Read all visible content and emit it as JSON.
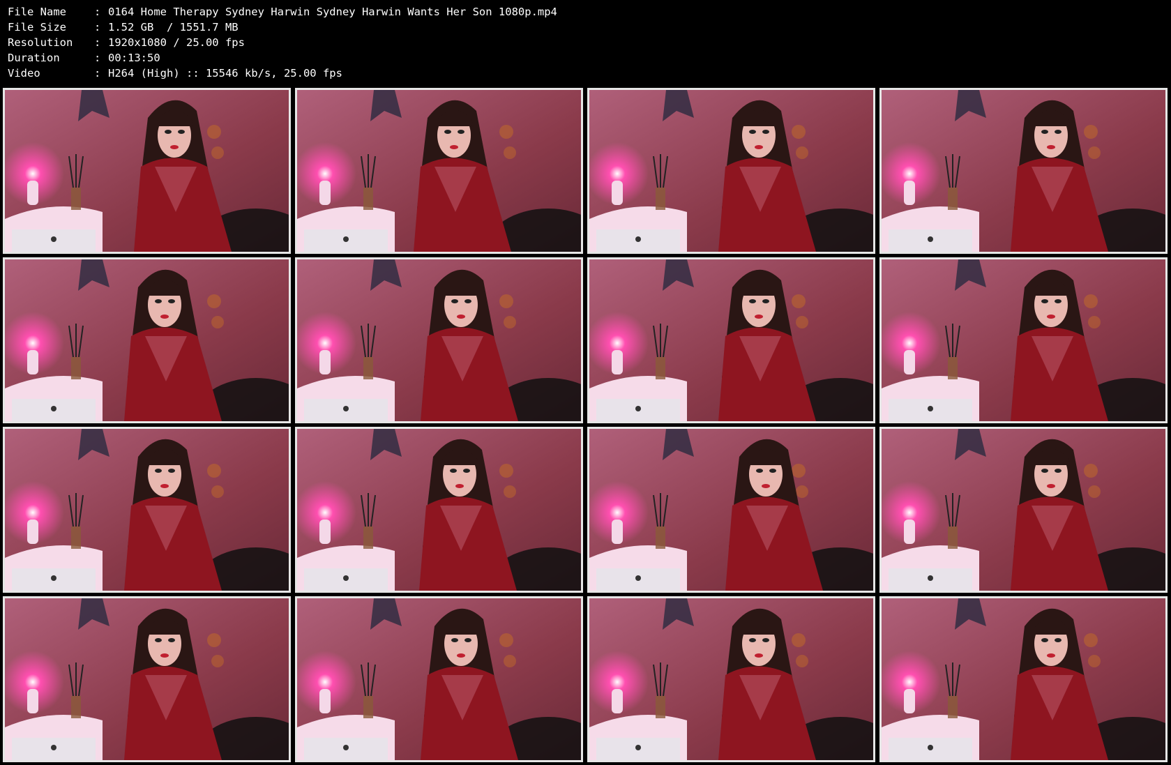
{
  "file_info": [
    {
      "label": "File Name",
      "sep": ":",
      "value": "0164 Home Therapy Sydney Harwin Sydney Harwin Wants Her Son 1080p.mp4"
    },
    {
      "label": "File Size",
      "sep": ":",
      "value": "1.52 GB  / 1551.7 MB"
    },
    {
      "label": "Resolution",
      "sep": ":",
      "value": "1920x1080 / 25.00 fps"
    },
    {
      "label": "Duration",
      "sep": ":",
      "value": "00:13:50"
    },
    {
      "label": "Video",
      "sep": ":",
      "value": "H264 (High) :: 15546 kb/s, 25.00 fps"
    }
  ],
  "thumbnail_count": 16,
  "colors": {
    "background": "#000000",
    "text": "#ffffff",
    "thumb_border": "#e6e6e6",
    "wall": "#8a3a4a",
    "lamp_glow": "#ff4fb0",
    "dress": "#8e1520",
    "hair": "#2a1614"
  }
}
